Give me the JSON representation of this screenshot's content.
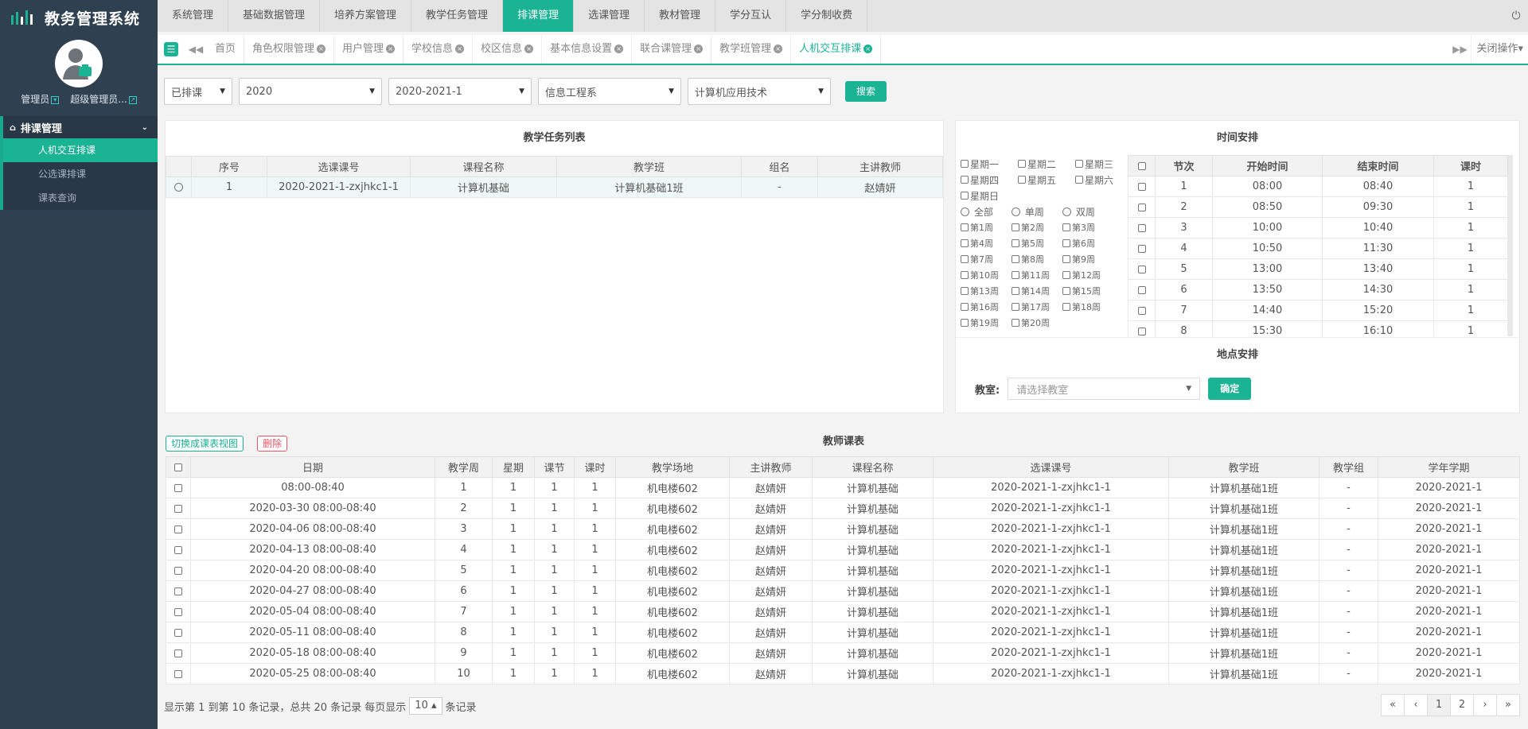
{
  "app": {
    "title": "教务管理系统"
  },
  "user": {
    "name": "管理员",
    "role": "超级管理员..."
  },
  "sidebar": {
    "section": "排课管理",
    "items": [
      {
        "label": "人机交互排课",
        "active": true
      },
      {
        "label": "公选课排课",
        "active": false
      },
      {
        "label": "课表查询",
        "active": false
      }
    ]
  },
  "topnav": {
    "items": [
      "系统管理",
      "基础数据管理",
      "培养方案管理",
      "教学任务管理",
      "排课管理",
      "选课管理",
      "教材管理",
      "学分互认",
      "学分制收费"
    ],
    "active_index": 4
  },
  "tabs": {
    "items": [
      "首页",
      "角色权限管理",
      "用户管理",
      "学校信息",
      "校区信息",
      "基本信息设置",
      "联合课管理",
      "教学班管理",
      "人机交互排课"
    ],
    "active_index": 8,
    "close_ops": "关闭操作"
  },
  "filters": {
    "status": "已排课",
    "year": "2020",
    "term": "2020-2021-1",
    "department": "信息工程系",
    "major": "计算机应用技术",
    "search_label": "搜索"
  },
  "task_list": {
    "title": "教学任务列表",
    "headers": [
      "序号",
      "选课课号",
      "课程名称",
      "教学班",
      "组名",
      "主讲教师"
    ],
    "rows": [
      [
        "1",
        "2020-2021-1-zxjhkc1-1",
        "计算机基础",
        "计算机基础1班",
        "-",
        "赵婧妍"
      ]
    ]
  },
  "time_panel": {
    "title": "时间安排",
    "weekdays": [
      "星期一",
      "星期二",
      "星期三",
      "星期四",
      "星期五",
      "星期六",
      "星期日"
    ],
    "week_modes": [
      "全部",
      "单周",
      "双周"
    ],
    "weeks": [
      "第1周",
      "第2周",
      "第3周",
      "第4周",
      "第5周",
      "第6周",
      "第7周",
      "第8周",
      "第9周",
      "第10周",
      "第11周",
      "第12周",
      "第13周",
      "第14周",
      "第15周",
      "第16周",
      "第17周",
      "第18周",
      "第19周",
      "第20周"
    ],
    "period_headers": [
      "节次",
      "开始时间",
      "结束时间",
      "课时"
    ],
    "periods": [
      [
        "1",
        "08:00",
        "08:40",
        "1"
      ],
      [
        "2",
        "08:50",
        "09:30",
        "1"
      ],
      [
        "3",
        "10:00",
        "10:40",
        "1"
      ],
      [
        "4",
        "10:50",
        "11:30",
        "1"
      ],
      [
        "5",
        "13:00",
        "13:40",
        "1"
      ],
      [
        "6",
        "13:50",
        "14:30",
        "1"
      ],
      [
        "7",
        "14:40",
        "15:20",
        "1"
      ],
      [
        "8",
        "15:30",
        "16:10",
        "1"
      ]
    ]
  },
  "place_panel": {
    "title": "地点安排",
    "classroom_label": "教室:",
    "classroom_placeholder": "请选择教室",
    "confirm_label": "确定"
  },
  "schedule": {
    "title": "教师课表",
    "switch_label": "切换成课表视图",
    "delete_label": "删除",
    "headers": [
      "日期",
      "教学周",
      "星期",
      "课节",
      "课时",
      "教学场地",
      "主讲教师",
      "课程名称",
      "选课课号",
      "教学班",
      "教学组",
      "学年学期"
    ],
    "rows": [
      [
        "08:00-08:40",
        "1",
        "1",
        "1",
        "1",
        "机电楼602",
        "赵婧妍",
        "计算机基础",
        "2020-2021-1-zxjhkc1-1",
        "计算机基础1班",
        "-",
        "2020-2021-1"
      ],
      [
        "2020-03-30 08:00-08:40",
        "2",
        "1",
        "1",
        "1",
        "机电楼602",
        "赵婧妍",
        "计算机基础",
        "2020-2021-1-zxjhkc1-1",
        "计算机基础1班",
        "-",
        "2020-2021-1"
      ],
      [
        "2020-04-06 08:00-08:40",
        "3",
        "1",
        "1",
        "1",
        "机电楼602",
        "赵婧妍",
        "计算机基础",
        "2020-2021-1-zxjhkc1-1",
        "计算机基础1班",
        "-",
        "2020-2021-1"
      ],
      [
        "2020-04-13 08:00-08:40",
        "4",
        "1",
        "1",
        "1",
        "机电楼602",
        "赵婧妍",
        "计算机基础",
        "2020-2021-1-zxjhkc1-1",
        "计算机基础1班",
        "-",
        "2020-2021-1"
      ],
      [
        "2020-04-20 08:00-08:40",
        "5",
        "1",
        "1",
        "1",
        "机电楼602",
        "赵婧妍",
        "计算机基础",
        "2020-2021-1-zxjhkc1-1",
        "计算机基础1班",
        "-",
        "2020-2021-1"
      ],
      [
        "2020-04-27 08:00-08:40",
        "6",
        "1",
        "1",
        "1",
        "机电楼602",
        "赵婧妍",
        "计算机基础",
        "2020-2021-1-zxjhkc1-1",
        "计算机基础1班",
        "-",
        "2020-2021-1"
      ],
      [
        "2020-05-04 08:00-08:40",
        "7",
        "1",
        "1",
        "1",
        "机电楼602",
        "赵婧妍",
        "计算机基础",
        "2020-2021-1-zxjhkc1-1",
        "计算机基础1班",
        "-",
        "2020-2021-1"
      ],
      [
        "2020-05-11 08:00-08:40",
        "8",
        "1",
        "1",
        "1",
        "机电楼602",
        "赵婧妍",
        "计算机基础",
        "2020-2021-1-zxjhkc1-1",
        "计算机基础1班",
        "-",
        "2020-2021-1"
      ],
      [
        "2020-05-18 08:00-08:40",
        "9",
        "1",
        "1",
        "1",
        "机电楼602",
        "赵婧妍",
        "计算机基础",
        "2020-2021-1-zxjhkc1-1",
        "计算机基础1班",
        "-",
        "2020-2021-1"
      ],
      [
        "2020-05-25 08:00-08:40",
        "10",
        "1",
        "1",
        "1",
        "机电楼602",
        "赵婧妍",
        "计算机基础",
        "2020-2021-1-zxjhkc1-1",
        "计算机基础1班",
        "-",
        "2020-2021-1"
      ]
    ]
  },
  "pager": {
    "info_prefix": "显示第 1 到第 10 条记录，总共 20 条记录 每页显示",
    "page_size": "10 ▴",
    "info_suffix": "条记录",
    "buttons": [
      "«",
      "‹",
      "1",
      "2",
      "›",
      "»"
    ],
    "active_page": "1"
  },
  "icons": {
    "brand": "bar-chart-logo",
    "avatar": "user-avatar",
    "power": "power-icon"
  },
  "colors": {
    "accent": "#1ab394",
    "sidebar": "#2f4050",
    "danger": "#ed5565"
  }
}
